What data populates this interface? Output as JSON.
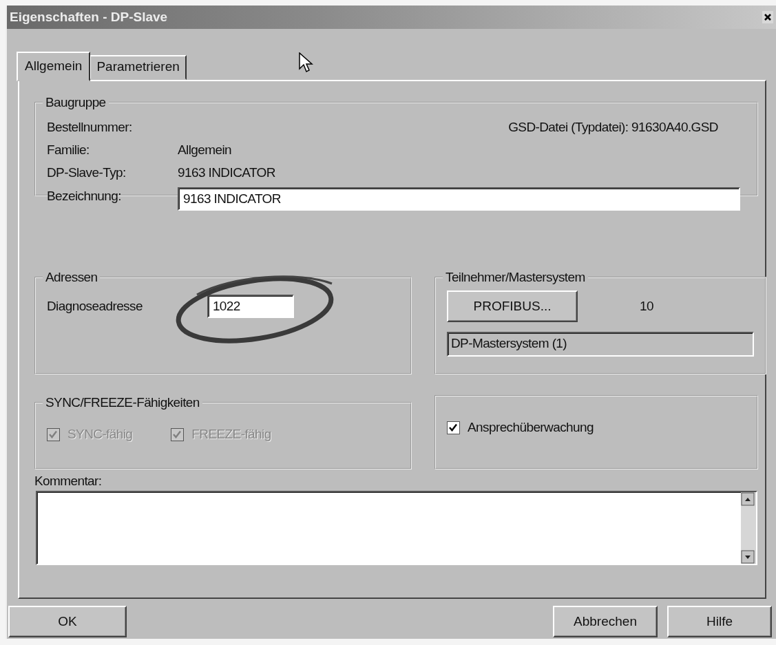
{
  "window": {
    "title": "Eigenschaften - DP-Slave"
  },
  "tabs": [
    {
      "label": "Allgemein",
      "selected": true
    },
    {
      "label": "Parametrieren",
      "selected": false
    }
  ],
  "baugruppe": {
    "title": "Baugruppe",
    "order_label": "Bestellnummer:",
    "gsd": "GSD-Datei (Typdatei): 91630A40.GSD",
    "rows": [
      {
        "label": "Familie:",
        "value": "Allgemein"
      },
      {
        "label": "DP-Slave-Typ:",
        "value": "9163 INDICATOR"
      }
    ],
    "name_label": "Bezeichnung:",
    "name_value": "9163 INDICATOR"
  },
  "adressen": {
    "title": "Adressen",
    "label": "Diagnoseadresse",
    "value": "1022"
  },
  "teilnehmer": {
    "title": "Teilnehmer/Mastersystem",
    "button": "PROFIBUS...",
    "address": "10",
    "system": "DP-Mastersystem (1)"
  },
  "sync": {
    "title": "SYNC/FREEZE-Fähigkeiten",
    "options": [
      {
        "label": "SYNC-fähig",
        "checked": true,
        "disabled": true
      },
      {
        "label": "FREEZE-fähig",
        "checked": true,
        "disabled": true
      }
    ]
  },
  "monitoring": {
    "label": "Ansprechüberwachung",
    "checked": true,
    "disabled": false
  },
  "kommentar": {
    "label": "Kommentar:"
  },
  "buttons": [
    {
      "label": "OK"
    },
    {
      "label": "Abbrechen"
    },
    {
      "label": "Hilfe"
    }
  ]
}
